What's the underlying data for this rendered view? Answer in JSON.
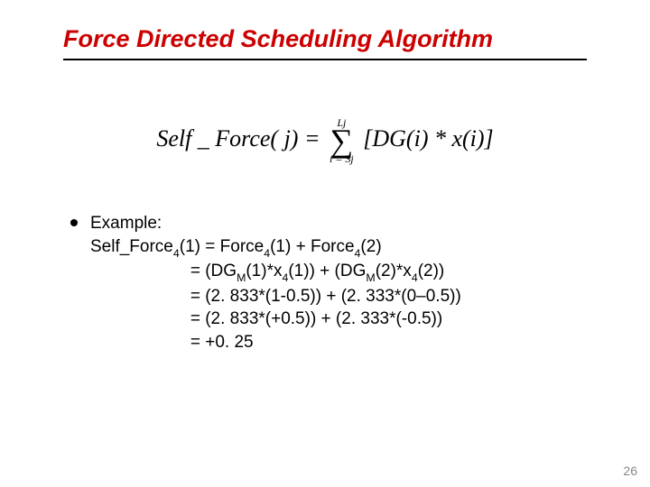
{
  "title": "Force Directed Scheduling Algorithm",
  "formula": {
    "lhs": "Self _ Force( j) =",
    "upper": "Lj",
    "lower": "i = Sj",
    "rhs": "[DG(i) * x(i)]"
  },
  "example": {
    "heading": "Example:",
    "lhs": "Self_Force",
    "lhs_sub": "4",
    "lhs_arg": "(1)",
    "eq1_a": "Force",
    "eq1_a_sub": "4",
    "eq1_a_arg": "(1) + Force",
    "eq1_b_sub": "4",
    "eq1_b_arg": "(2)",
    "eq2_a": "(DG",
    "eq2_a_sub": "M",
    "eq2_b": "(1)*x",
    "eq2_b_sub": "4",
    "eq2_c": "(1)) + (DG",
    "eq2_c_sub": "M",
    "eq2_d": "(2)*x",
    "eq2_d_sub": "4",
    "eq2_e": "(2))",
    "eq3": "(2. 833*(1-0.5)) + (2. 333*(0–0.5))",
    "eq4": "(2. 833*(+0.5)) + (2. 333*(-0.5))",
    "eq5": "+0. 25"
  },
  "page_number": "26"
}
